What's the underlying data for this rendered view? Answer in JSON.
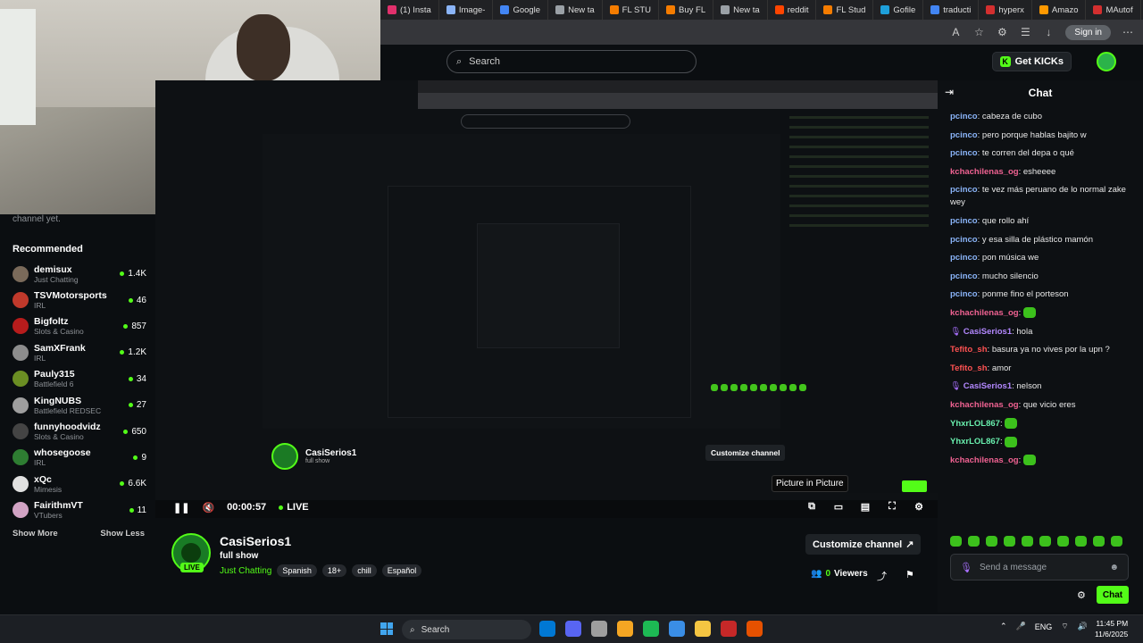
{
  "browser": {
    "tabs": [
      {
        "label": "(1) Insta",
        "color": "#e1306c"
      },
      {
        "label": "Image-",
        "color": "#8ab4f8"
      },
      {
        "label": "Google",
        "color": "#4285f4"
      },
      {
        "label": "New ta",
        "color": "#9aa0a6"
      },
      {
        "label": "FL STU",
        "color": "#f57c00"
      },
      {
        "label": "Buy FL",
        "color": "#f57c00"
      },
      {
        "label": "New ta",
        "color": "#9aa0a6"
      },
      {
        "label": "reddit",
        "color": "#ff4500"
      },
      {
        "label": "FL Stud",
        "color": "#f57c00"
      },
      {
        "label": "Gofile",
        "color": "#1ea0db"
      },
      {
        "label": "traducti",
        "color": "#4285f4"
      },
      {
        "label": "hyperx",
        "color": "#d32f2f"
      },
      {
        "label": "Amazo",
        "color": "#ff9900"
      },
      {
        "label": "MAutof",
        "color": "#d32f2f"
      }
    ],
    "signin_label": "Sign in"
  },
  "kick": {
    "search_placeholder": "Search",
    "get_kicks_label": "Get KICKs"
  },
  "sidebar": {
    "cut_text": "channel yet.",
    "title": "Recommended",
    "items": [
      {
        "name": "demisux",
        "category": "Just Chatting",
        "viewers": "1.4K",
        "avatar": "#7a6a5a"
      },
      {
        "name": "TSVMotorsports",
        "category": "IRL",
        "viewers": "46",
        "avatar": "#c0392b"
      },
      {
        "name": "Bigfoltz",
        "category": "Slots & Casino",
        "viewers": "857",
        "avatar": "#b71c1c"
      },
      {
        "name": "SamXFrank",
        "category": "IRL",
        "viewers": "1.2K",
        "avatar": "#8d8d8d"
      },
      {
        "name": "Pauly315",
        "category": "Battlefield 6",
        "viewers": "34",
        "avatar": "#6b8e23"
      },
      {
        "name": "KingNUBS",
        "category": "Battlefield REDSEC",
        "viewers": "27",
        "avatar": "#9e9e9e"
      },
      {
        "name": "funnyhoodvidz",
        "category": "Slots & Casino",
        "viewers": "650",
        "avatar": "#444444"
      },
      {
        "name": "whosegoose",
        "category": "IRL",
        "viewers": "9",
        "avatar": "#2e7d32"
      },
      {
        "name": "xQc",
        "category": "Mimesis",
        "viewers": "6.6K",
        "avatar": "#e0e0e0"
      },
      {
        "name": "FairithmVT",
        "category": "VTubers",
        "viewers": "11",
        "avatar": "#d1a3c4"
      }
    ],
    "show_more": "Show More",
    "show_less": "Show Less"
  },
  "inner_stream": {
    "name": "CasiSerios1",
    "sub": "full show",
    "customize": "Customize channel"
  },
  "player": {
    "time": "00:00:57",
    "live": "LIVE",
    "tooltip": "Picture in Picture"
  },
  "channel": {
    "name": "CasiSerios1",
    "title": "full show",
    "category": "Just Chatting",
    "tags": [
      "Spanish",
      "18+",
      "chill",
      "Español"
    ],
    "live_badge": "LIVE",
    "customize_label": "Customize channel",
    "viewers_num": "0",
    "viewers_label": "Viewers"
  },
  "chat": {
    "title": "Chat",
    "messages": [
      {
        "user": "pcinco",
        "color": "#8ab4f8",
        "text": "cabeza de cubo"
      },
      {
        "user": "pcinco",
        "color": "#8ab4f8",
        "text": "pero porque hablas bajito w"
      },
      {
        "user": "pcinco",
        "color": "#8ab4f8",
        "text": "te corren del depa o qué"
      },
      {
        "user": "kchachilenas_og",
        "color": "#f06292",
        "text": "esheeee"
      },
      {
        "user": "pcinco",
        "color": "#8ab4f8",
        "text": "te vez más peruano de lo normal zake wey"
      },
      {
        "user": "pcinco",
        "color": "#8ab4f8",
        "text": "que rollo ahí"
      },
      {
        "user": "pcinco",
        "color": "#8ab4f8",
        "text": "y esa silla de plástico mamón"
      },
      {
        "user": "pcinco",
        "color": "#8ab4f8",
        "text": "pon música we"
      },
      {
        "user": "pcinco",
        "color": "#8ab4f8",
        "text": "mucho silencio"
      },
      {
        "user": "pcinco",
        "color": "#8ab4f8",
        "text": "ponme fino el porteson"
      },
      {
        "user": "kchachilenas_og",
        "color": "#f06292",
        "text": ""
      },
      {
        "user": "CasiSerios1",
        "color": "#b388ff",
        "text": "hola"
      },
      {
        "user": "Tefito_sh",
        "color": "#ff5252",
        "text": "basura ya no vives por la upn ?"
      },
      {
        "user": "Tefito_sh",
        "color": "#ff5252",
        "text": "amor"
      },
      {
        "user": "CasiSerios1",
        "color": "#b388ff",
        "text": "nelson"
      },
      {
        "user": "kchachilenas_og",
        "color": "#f06292",
        "text": "que vicio eres"
      },
      {
        "user": "YhxrLOL867",
        "color": "#69f0ae",
        "text": ""
      },
      {
        "user": "YhxrLOL867",
        "color": "#69f0ae",
        "text": ""
      },
      {
        "user": "kchachilenas_og",
        "color": "#f06292",
        "text": ""
      }
    ],
    "input_placeholder": "Send a message",
    "send_label": "Chat"
  },
  "taskbar": {
    "search_label": "Search",
    "lang": "ENG",
    "time": "11:45 PM",
    "date": "11/6/2025",
    "app_colors": [
      "#0078d4",
      "#5865f2",
      "#9e9e9e",
      "#f5a623",
      "#1db954",
      "#3a8ee6",
      "#f4c542",
      "#c62828",
      "#e65100"
    ]
  }
}
